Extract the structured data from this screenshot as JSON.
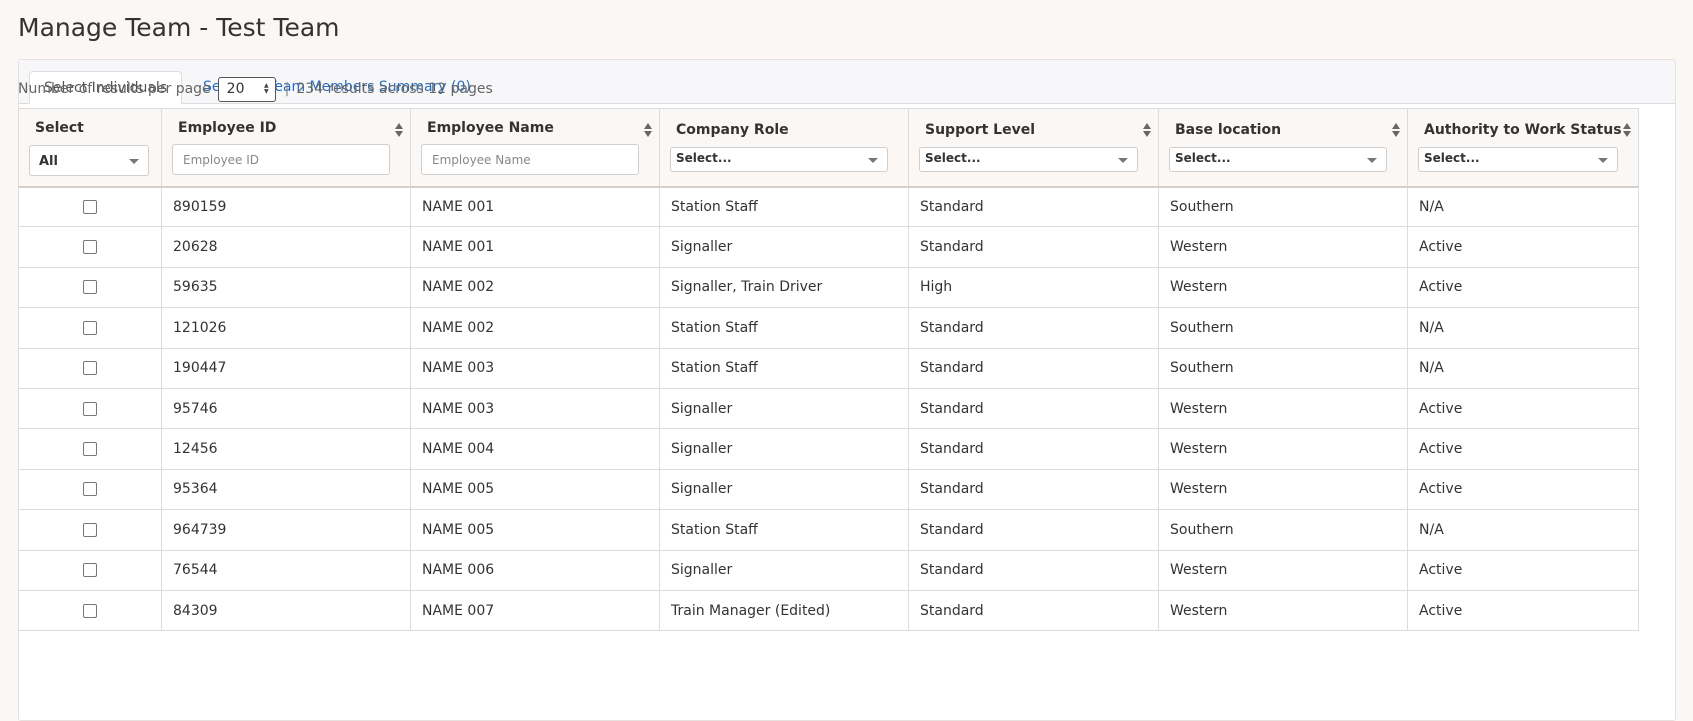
{
  "page": {
    "title": "Manage Team - Test Team"
  },
  "tabs": [
    {
      "label": "Select Individuals",
      "active": true
    },
    {
      "label": "Selected Team Members Summary (0)",
      "active": false
    }
  ],
  "toolbar": {
    "per_page_label": "Number of results per page",
    "per_page_value": "20",
    "separator": "|",
    "results_summary": "234 results across 12 pages"
  },
  "columns": {
    "select": {
      "label": "Select",
      "filter_value": "All"
    },
    "employee_id": {
      "label": "Employee ID",
      "placeholder": "Employee ID"
    },
    "employee_name": {
      "label": "Employee Name",
      "placeholder": "Employee Name"
    },
    "company_role": {
      "label": "Company Role",
      "filter_value": "Select..."
    },
    "support_level": {
      "label": "Support Level",
      "filter_value": "Select..."
    },
    "base_location": {
      "label": "Base location",
      "filter_value": "Select..."
    },
    "authority_status": {
      "label": "Authority to Work Status",
      "filter_value": "Select..."
    }
  },
  "rows": [
    {
      "id": "890159",
      "name": "NAME 001",
      "role": "Station Staff",
      "level": "Standard",
      "location": "Southern",
      "status": "N/A"
    },
    {
      "id": "20628",
      "name": "NAME 001",
      "role": "Signaller",
      "level": "Standard",
      "location": "Western",
      "status": "Active"
    },
    {
      "id": "59635",
      "name": "NAME 002",
      "role": "Signaller, Train Driver",
      "level": "High",
      "location": "Western",
      "status": "Active"
    },
    {
      "id": "121026",
      "name": "NAME 002",
      "role": "Station Staff",
      "level": "Standard",
      "location": "Southern",
      "status": "N/A"
    },
    {
      "id": "190447",
      "name": "NAME 003",
      "role": "Station Staff",
      "level": "Standard",
      "location": "Southern",
      "status": "N/A"
    },
    {
      "id": "95746",
      "name": "NAME 003",
      "role": "Signaller",
      "level": "Standard",
      "location": "Western",
      "status": "Active"
    },
    {
      "id": "12456",
      "name": "NAME 004",
      "role": "Signaller",
      "level": "Standard",
      "location": "Western",
      "status": "Active"
    },
    {
      "id": "95364",
      "name": "NAME 005",
      "role": "Signaller",
      "level": "Standard",
      "location": "Western",
      "status": "Active"
    },
    {
      "id": "964739",
      "name": "NAME 005",
      "role": "Station Staff",
      "level": "Standard",
      "location": "Southern",
      "status": "N/A"
    },
    {
      "id": "76544",
      "name": "NAME 006",
      "role": "Signaller",
      "level": "Standard",
      "location": "Western",
      "status": "Active"
    },
    {
      "id": "84309",
      "name": "NAME 007",
      "role": "Train Manager (Edited)",
      "level": "Standard",
      "location": "Western",
      "status": "Active"
    }
  ],
  "icons": {
    "sort": "sort-icon",
    "dropdown": "chevron-down-icon",
    "spinner": "spinner-icon"
  },
  "colors": {
    "level_standard": "#3c9a57",
    "level_high": "#d9383a",
    "link": "#2a6ebb"
  }
}
